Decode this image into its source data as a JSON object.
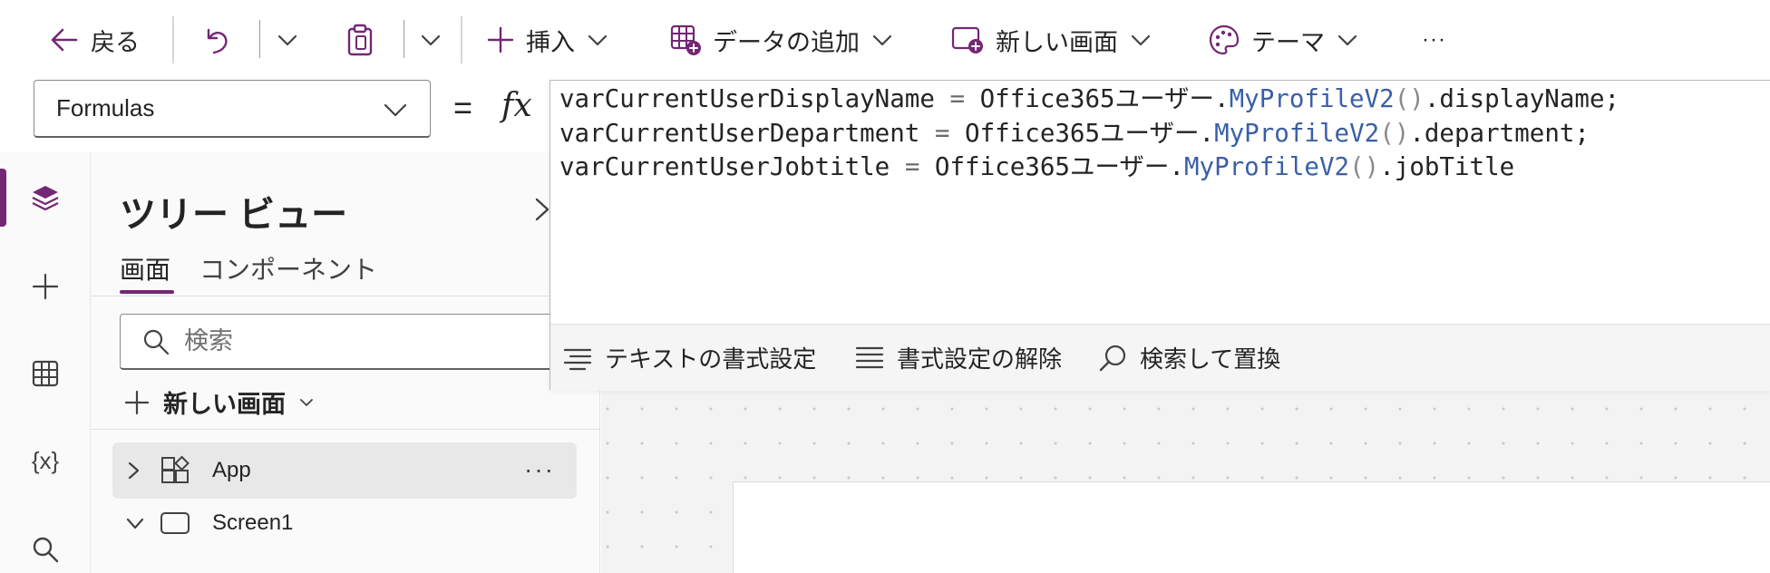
{
  "command_bar": {
    "back_label": "戻る",
    "insert_label": "挿入",
    "add_data_label": "データの追加",
    "new_screen_label": "新しい画面",
    "theme_label": "テーマ",
    "more_label": "···"
  },
  "formula_bar": {
    "property": "Formulas",
    "equals": "=",
    "fx": "fx"
  },
  "editor": {
    "lines": [
      [
        {
          "t": "varCurrentUserDisplayName ",
          "c": "plain"
        },
        {
          "t": "=",
          "c": "op"
        },
        {
          "t": " Office365ユーザー.",
          "c": "plain"
        },
        {
          "t": "MyProfileV2",
          "c": "fn"
        },
        {
          "t": "()",
          "c": "paren"
        },
        {
          "t": ".displayName;",
          "c": "plain"
        }
      ],
      [
        {
          "t": "varCurrentUserDepartment ",
          "c": "plain"
        },
        {
          "t": "=",
          "c": "op"
        },
        {
          "t": " Office365ユーザー.",
          "c": "plain"
        },
        {
          "t": "MyProfileV2",
          "c": "fn"
        },
        {
          "t": "()",
          "c": "paren"
        },
        {
          "t": ".department;",
          "c": "plain"
        }
      ],
      [
        {
          "t": "varCurrentUserJobtitle ",
          "c": "plain"
        },
        {
          "t": "=",
          "c": "op"
        },
        {
          "t": " Office365ユーザー.",
          "c": "plain"
        },
        {
          "t": "MyProfileV2",
          "c": "fn"
        },
        {
          "t": "()",
          "c": "paren"
        },
        {
          "t": ".jobTitle",
          "c": "plain"
        }
      ]
    ],
    "toolbar": {
      "format_text_label": "テキストの書式設定",
      "remove_format_label": "書式設定の解除",
      "find_replace_label": "検索して置換"
    }
  },
  "tree_view": {
    "title": "ツリー ビュー",
    "tabs": [
      {
        "label": "画面",
        "active": true
      },
      {
        "label": "コンポーネント",
        "active": false
      }
    ],
    "search_placeholder": "検索",
    "new_screen_label": "新しい画面",
    "nodes": [
      {
        "label": "App",
        "icon": "app-icon",
        "expanded": false,
        "selected": true,
        "more": "···"
      },
      {
        "label": "Screen1",
        "icon": "screen-icon",
        "expanded": true,
        "selected": false
      }
    ]
  },
  "left_rail": {
    "items": [
      "layers-icon",
      "plus-icon",
      "data-table-icon",
      "variables-icon",
      "search-icon"
    ],
    "variables_glyph": "{x}",
    "active_index": 0
  },
  "colors": {
    "accent": "#742774",
    "code_function": "#3a5fa8",
    "selected_node_bg": "#e8e8e8"
  }
}
